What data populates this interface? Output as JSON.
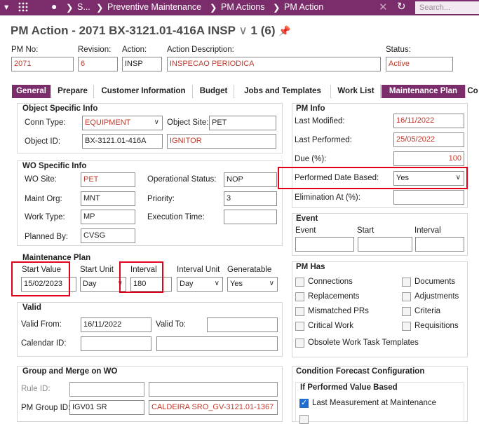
{
  "nav": {
    "breadcrumb": [
      "S...",
      "Preventive Maintenance",
      "PM Actions",
      "PM Action"
    ],
    "search_placeholder": "Search..."
  },
  "header": {
    "title": "PM Action - 2071 BX-3121.01-416A INSP",
    "record_counter": "1 (6)"
  },
  "summary": {
    "pm_no_label": "PM No:",
    "pm_no": "2071",
    "revision_label": "Revision:",
    "revision": "6",
    "action_label": "Action:",
    "action": "INSP",
    "action_desc_label": "Action Description:",
    "action_desc": "INSPECAO PERIODICA",
    "status_label": "Status:",
    "status": "Active"
  },
  "tabs": [
    "General",
    "Prepare",
    "Customer Information",
    "Budget",
    "Jobs and Templates",
    "Work List",
    "Maintenance Plan",
    "Co"
  ],
  "object_info": {
    "title": "Object Specific Info",
    "conn_type_label": "Conn Type:",
    "conn_type": "EQUIPMENT",
    "object_site_label": "Object Site:",
    "object_site": "PET",
    "object_id_label": "Object ID:",
    "object_id": "BX-3121.01-416A",
    "object_desc": "IGNITOR"
  },
  "wo_info": {
    "title": "WO Specific Info",
    "wo_site_label": "WO Site:",
    "wo_site": "PET",
    "op_status_label": "Operational Status:",
    "op_status": "NOP",
    "maint_org_label": "Maint Org:",
    "maint_org": "MNT",
    "priority_label": "Priority:",
    "priority": "3",
    "work_type_label": "Work Type:",
    "work_type": "MP",
    "exec_time_label": "Execution Time:",
    "exec_time": "",
    "planned_by_label": "Planned By:",
    "planned_by": "CVSG"
  },
  "maint_plan": {
    "title": "Maintenance Plan",
    "start_value_label": "Start Value",
    "start_value": "15/02/2023",
    "start_unit_label": "Start Unit",
    "start_unit": "Day",
    "interval_label": "Interval",
    "interval": "180",
    "interval_unit_label": "Interval Unit",
    "interval_unit": "Day",
    "generatable_label": "Generatable",
    "generatable": "Yes"
  },
  "valid": {
    "title": "Valid",
    "valid_from_label": "Valid From:",
    "valid_from": "16/11/2022",
    "valid_to_label": "Valid To:",
    "valid_to": "",
    "calendar_id_label": "Calendar ID:",
    "calendar_id": ""
  },
  "group_merge": {
    "title": "Group and Merge on WO",
    "rule_id_label": "Rule ID:",
    "rule_id": "",
    "pm_group_id_label": "PM Group ID:",
    "pm_group_id": "IGV01 SR",
    "pm_group_desc": "CALDEIRA SRO_GV-3121.01-1367"
  },
  "pm_info": {
    "title": "PM Info",
    "last_modified_label": "Last Modified:",
    "last_modified": "16/11/2022",
    "last_performed_label": "Last Performed:",
    "last_performed": "25/05/2022",
    "due_label": "Due (%):",
    "due": "100",
    "perf_date_based_label": "Performed Date Based:",
    "perf_date_based": "Yes",
    "elimination_label": "Elimination At (%):",
    "elimination": ""
  },
  "event": {
    "title": "Event",
    "event_label": "Event",
    "start_label": "Start",
    "interval_label": "Interval"
  },
  "pm_has": {
    "title": "PM Has",
    "left": [
      "Connections",
      "Replacements",
      "Mismatched PRs",
      "Critical Work"
    ],
    "right": [
      "Documents",
      "Adjustments",
      "Criteria",
      "Requisitions"
    ],
    "obsolete": "Obsolete Work Task Templates"
  },
  "forecast": {
    "title": "Condition Forecast Configuration",
    "sub_title": "If Performed Value Based",
    "last_measurement": "Last Measurement at Maintenance"
  },
  "colors": {
    "brand": "#7b2d6b",
    "highlight": "#e0001a",
    "value_red": "#c0392b"
  }
}
